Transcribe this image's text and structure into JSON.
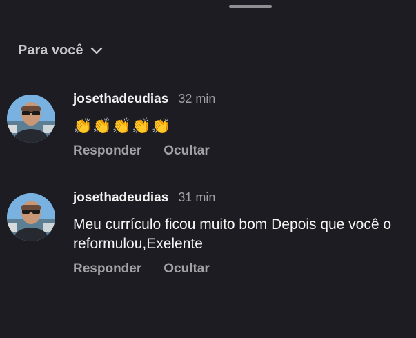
{
  "sheet": {
    "filter_label": "Para você",
    "filter_icon": "chevron-down-icon"
  },
  "comments": [
    {
      "username": "josethadeudias",
      "time": "32 min",
      "text": "👏👏👏👏👏",
      "actions": [
        "Responder",
        "Ocultar"
      ]
    },
    {
      "username": "josethadeudias",
      "time": "31 min",
      "text": "Meu currículo ficou muito bom Depois que você o reformulou,Exelente",
      "actions": [
        "Responder",
        "Ocultar"
      ]
    }
  ]
}
